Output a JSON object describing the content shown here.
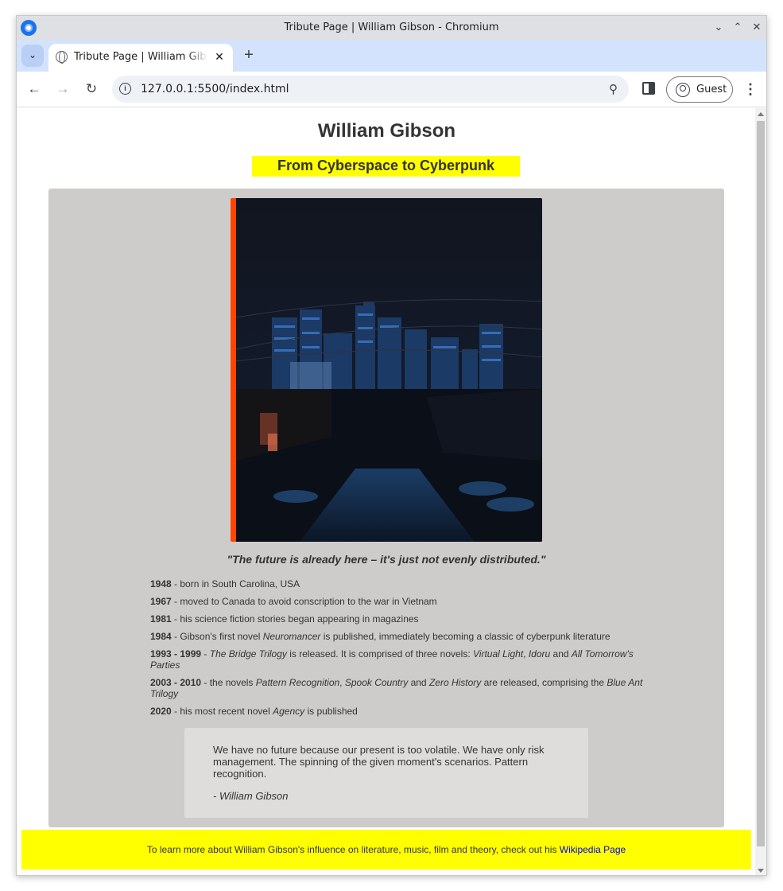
{
  "browser": {
    "window_title": "Tribute Page | William Gibson - Chromium",
    "tab_title": "Tribute Page | William Gibson",
    "url": "127.0.0.1:5500/index.html",
    "profile_label": "Guest",
    "icons": {
      "app": "chromium-logo-icon",
      "tab_search": "chevron-down-icon",
      "tab_favicon": "globe-icon",
      "tab_close": "close-icon",
      "new_tab": "plus-icon",
      "back": "back-arrow-icon",
      "forward": "forward-arrow-icon",
      "reload": "reload-icon",
      "site_info": "info-icon",
      "zoom": "zoom-icon",
      "side_panel": "side-panel-icon",
      "profile": "person-icon",
      "menu": "kebab-menu-icon"
    }
  },
  "page": {
    "title": "William Gibson",
    "subtitle": "From Cyberspace to Cyberpunk",
    "image": "night-city-skyline-image",
    "caption": "\"The future is already here – it's just not evenly distributed.\"",
    "timeline": [
      {
        "year": "1948",
        "parts": [
          {
            "t": " - born in South Carolina, USA"
          }
        ]
      },
      {
        "year": "1967",
        "parts": [
          {
            "t": " - moved to Canada to avoid conscription to the war in Vietnam"
          }
        ]
      },
      {
        "year": "1981",
        "parts": [
          {
            "t": " - his science fiction stories began appearing in magazines"
          }
        ]
      },
      {
        "year": "1984",
        "parts": [
          {
            "t": " - Gibson's first novel "
          },
          {
            "i": "Neuromancer"
          },
          {
            "t": " is published, immediately becoming a classic of cyberpunk literature"
          }
        ]
      },
      {
        "year": "1993 - 1999",
        "parts": [
          {
            "t": " - "
          },
          {
            "i": "The Bridge Trilogy"
          },
          {
            "t": " is released. It is comprised of three novels: "
          },
          {
            "i": "Virtual Light"
          },
          {
            "t": ", "
          },
          {
            "i": "Idoru"
          },
          {
            "t": " and "
          },
          {
            "i": "All Tomorrow's Parties"
          }
        ]
      },
      {
        "year": "2003 - 2010",
        "parts": [
          {
            "t": " - the novels "
          },
          {
            "i": "Pattern Recognition"
          },
          {
            "t": ", "
          },
          {
            "i": "Spook Country"
          },
          {
            "t": " and "
          },
          {
            "i": "Zero History"
          },
          {
            "t": " are released, comprising the "
          },
          {
            "i": "Blue Ant Trilogy"
          }
        ]
      },
      {
        "year": "2020",
        "parts": [
          {
            "t": " - his most recent novel "
          },
          {
            "i": "Agency"
          },
          {
            "t": " is published"
          }
        ]
      }
    ],
    "blockquote": {
      "text": "We have no future because our present is too volatile. We have only risk management. The spinning of the given moment's scenarios. Pattern recognition.",
      "author": "- William Gibson"
    },
    "footer": {
      "text": "To learn more about William Gibson's influence on literature, music, film and theory, check out his ",
      "link_label": "Wikipedia Page"
    },
    "colors": {
      "highlight": "#ffff00",
      "card": "#cecccb",
      "image_accent": "#ff4500",
      "link": "#0000ee"
    }
  }
}
